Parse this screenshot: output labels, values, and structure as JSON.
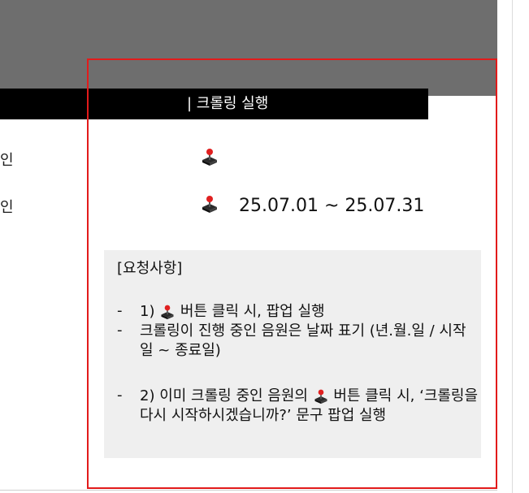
{
  "header": {
    "bar_title": "| 크롤링 실행"
  },
  "rows": [
    {
      "label": "인",
      "date": ""
    },
    {
      "label": "인",
      "date": "25.07.01 ~ 25.07.31"
    }
  ],
  "icons": {
    "crawl": "joystick-icon"
  },
  "notes": {
    "title": "[요청사항]",
    "item1_prefix": "1) ",
    "item1_suffix": " 버튼 클릭 시, 팝업 실행",
    "item2": "크롤링이 진행 중인 음원은 날짜 표기 (년.월.일 / 시작일 ~ 종료일)",
    "item3_prefix": "2) 이미 크롤링 중인 음원의 ",
    "item3_suffix": " 버튼 클릭 시, ‘크롤링을 다시 시작하시겠습니까?’ 문구 팝업 실행",
    "dash": "-"
  },
  "colors": {
    "highlight_border": "#e21b1b",
    "bar": "#000000",
    "backdrop": "#6e6e6e"
  }
}
